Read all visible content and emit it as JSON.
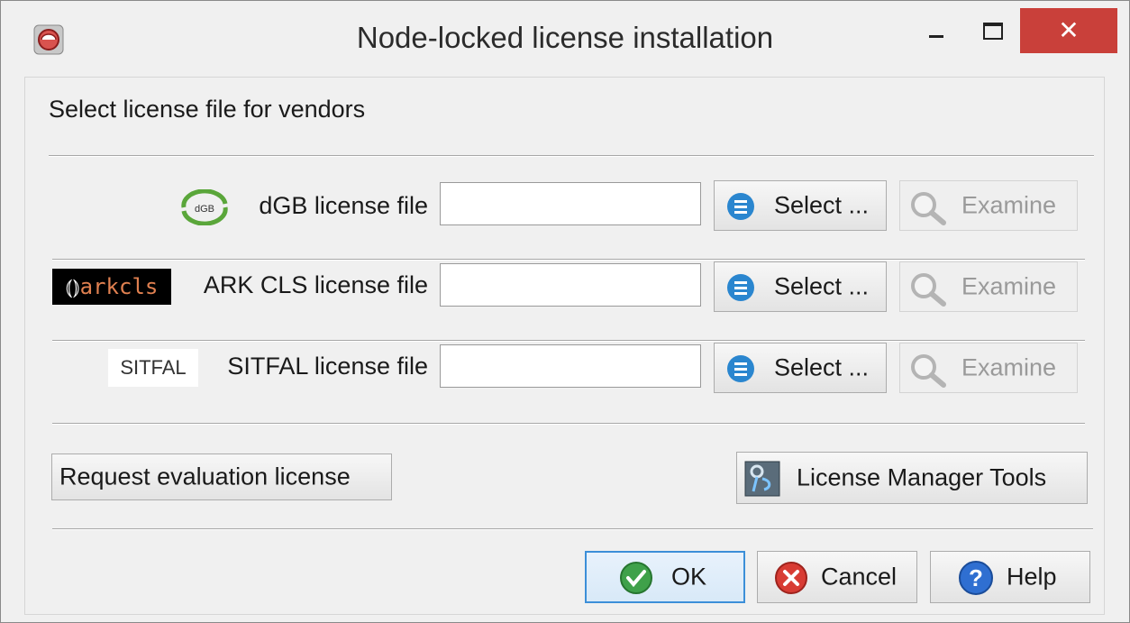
{
  "window": {
    "title": "Node-locked license installation",
    "close_glyph": "✕",
    "accent_close": "#c9403a"
  },
  "main": {
    "heading": "Select license file for vendors",
    "vendors": [
      {
        "logo_text": "dGB",
        "label": "dGB license file",
        "value": "",
        "select_label": "Select ...",
        "examine_label": "Examine"
      },
      {
        "logo_text": "arkcls",
        "label": "ARK CLS license file",
        "value": "",
        "select_label": "Select ...",
        "examine_label": "Examine"
      },
      {
        "logo_text": "SITFAL",
        "label": "SITFAL license file",
        "value": "",
        "select_label": "Select ...",
        "examine_label": "Examine"
      }
    ],
    "request_eval_label": "Request evaluation license",
    "lm_tools_label": "License Manager Tools"
  },
  "footer": {
    "ok_label": "OK",
    "cancel_label": "Cancel",
    "help_label": "Help"
  },
  "icons": {
    "app": "app-logo-icon",
    "select": "list-icon",
    "examine": "magnifier-icon",
    "lm_tools": "tools-icon",
    "ok": "check-icon",
    "cancel": "cancel-icon",
    "help": "help-icon"
  }
}
